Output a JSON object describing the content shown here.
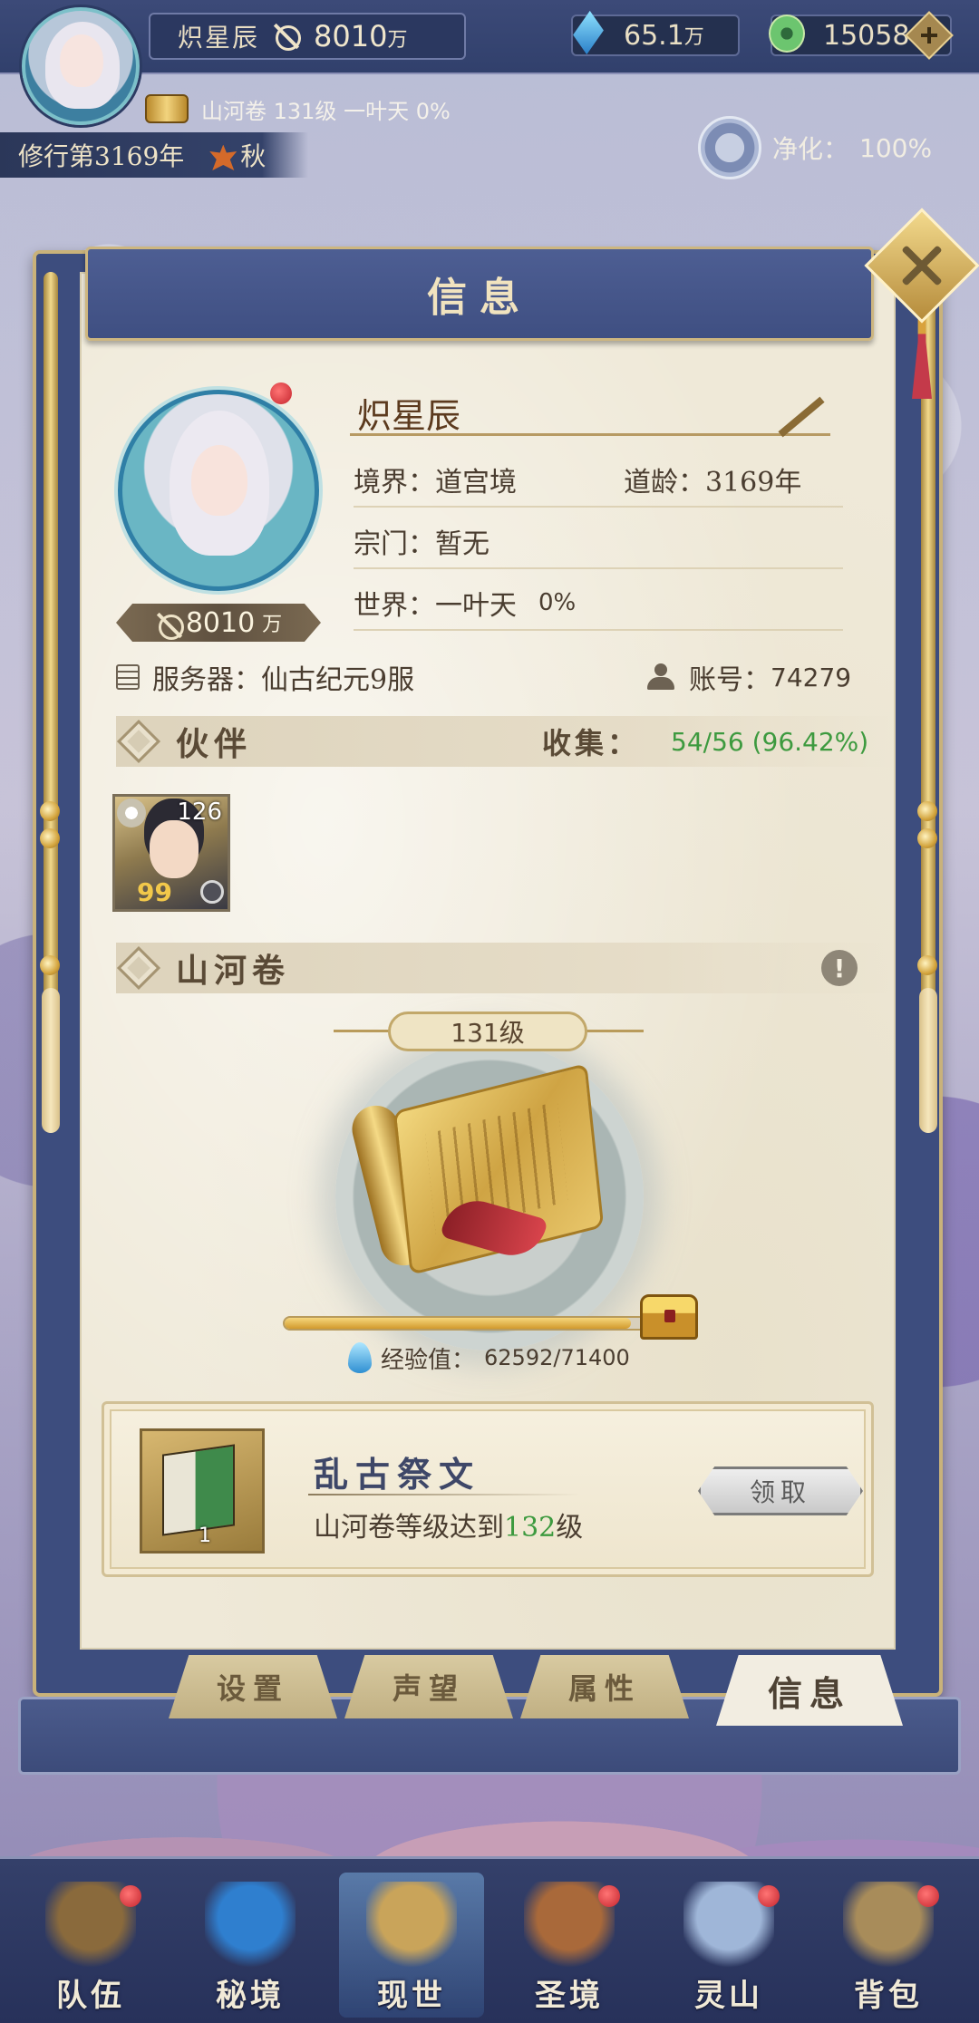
{
  "hud": {
    "player_name": "炽星辰",
    "combat_power": "8010",
    "combat_power_unit": "万",
    "crystal": "65.1",
    "crystal_unit": "万",
    "jade": "15058",
    "scroll_info": "山河卷 131级 一叶天 0%",
    "year": "修行第3169年",
    "season": "秋",
    "purify_label": "净化：",
    "purify_value": "100%"
  },
  "panel": {
    "title": "信息",
    "name": "炽星辰",
    "realm_label": "境界：",
    "realm": "道宫境",
    "age_label": "道龄：",
    "age": "3169年",
    "sect_label": "宗门：",
    "sect": "暂无",
    "world_label": "世界：",
    "world": "一叶天",
    "world_progress": "0%",
    "power": "8010",
    "power_unit": "万",
    "server_label": "服务器：",
    "server": "仙古纪元9服",
    "account_label": "账号：",
    "account": "74279"
  },
  "partner": {
    "title": "伙伴",
    "collect_label": "收集：",
    "collect_value": "54/56 (96.42%)",
    "cards": [
      {
        "level": "126",
        "quote_mark": "99"
      }
    ]
  },
  "scroll": {
    "title": "山河卷",
    "warn_icon": "!",
    "level": "131级",
    "exp_label": "经验值：",
    "exp_value": "62592/71400",
    "exp_progress": 0.8766
  },
  "reward": {
    "title": "乱古祭文",
    "desc_prefix": "山河卷等级达到",
    "desc_level": "132",
    "desc_suffix": "级",
    "item_count": "1",
    "claim_label": "领取"
  },
  "tabs": [
    {
      "label": "设置",
      "active": false
    },
    {
      "label": "声望",
      "active": false
    },
    {
      "label": "属性",
      "active": false
    },
    {
      "label": "信息",
      "active": true
    }
  ],
  "bottom_nav": [
    {
      "label": "队伍",
      "icon": "hat-icon",
      "color": "#8a6a3c",
      "badge": true
    },
    {
      "label": "秘境",
      "icon": "portal-icon",
      "color": "#2f7fcf",
      "badge": false
    },
    {
      "label": "现世",
      "icon": "scroll-icon",
      "color": "#c9a45a",
      "badge": false,
      "active": true
    },
    {
      "label": "圣境",
      "icon": "pavilion-icon",
      "color": "#a9693a",
      "badge": true
    },
    {
      "label": "灵山",
      "icon": "mountain-icon",
      "color": "#9fb6d8",
      "badge": true
    },
    {
      "label": "背包",
      "icon": "bag-icon",
      "color": "#a88c5a",
      "badge": true
    }
  ]
}
